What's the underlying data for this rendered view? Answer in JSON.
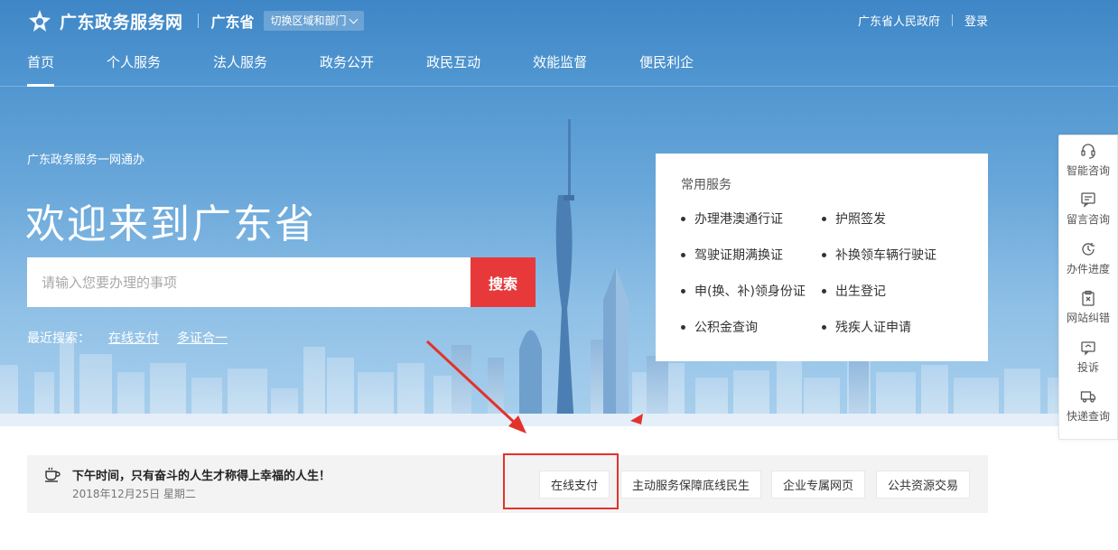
{
  "header": {
    "logo_text": "广东政务服务网",
    "region": "广东省",
    "switch_label": "切换区域和部门",
    "gov_link": "广东省人民政府",
    "login": "登录",
    "nav": [
      {
        "label": "首页",
        "active": true
      },
      {
        "label": "个人服务"
      },
      {
        "label": "法人服务"
      },
      {
        "label": "政务公开"
      },
      {
        "label": "政民互动"
      },
      {
        "label": "效能监督"
      },
      {
        "label": "便民利企"
      }
    ]
  },
  "hero": {
    "subtitle": "广东政务服务一网通办",
    "title": "欢迎来到广东省",
    "search": {
      "placeholder": "请输入您要办理的事项",
      "button": "搜索"
    },
    "recent": {
      "label": "最近搜索：",
      "items": [
        "在线支付",
        "多证合一"
      ]
    }
  },
  "services_card": {
    "title": "常用服务",
    "items": [
      "办理港澳通行证",
      "护照签发",
      "驾驶证期满换证",
      "补换领车辆行驶证",
      "申(换、补)领身份证",
      "出生登记",
      "公积金查询",
      "残疾人证申请"
    ]
  },
  "float_panel": [
    {
      "icon": "headset-icon",
      "label": "智能咨询"
    },
    {
      "icon": "message-icon",
      "label": "留言咨询"
    },
    {
      "icon": "progress-clock-icon",
      "label": "办件进度"
    },
    {
      "icon": "clipboard-x-icon",
      "label": "网站纠错"
    },
    {
      "icon": "complaint-icon",
      "label": "投诉"
    },
    {
      "icon": "truck-icon",
      "label": "快递查询"
    }
  ],
  "bar": {
    "greeting": "下午时间，只有奋斗的人生才称得上幸福的人生！",
    "date": "2018年12月25日 星期二",
    "quick_links": [
      "在线支付",
      "主动服务保障底线民生",
      "企业专属网页",
      "公共资源交易"
    ]
  },
  "colors": {
    "accent_red": "#e8393a",
    "annotation_red": "#e3322c",
    "sky_top": "#3e86c6"
  }
}
